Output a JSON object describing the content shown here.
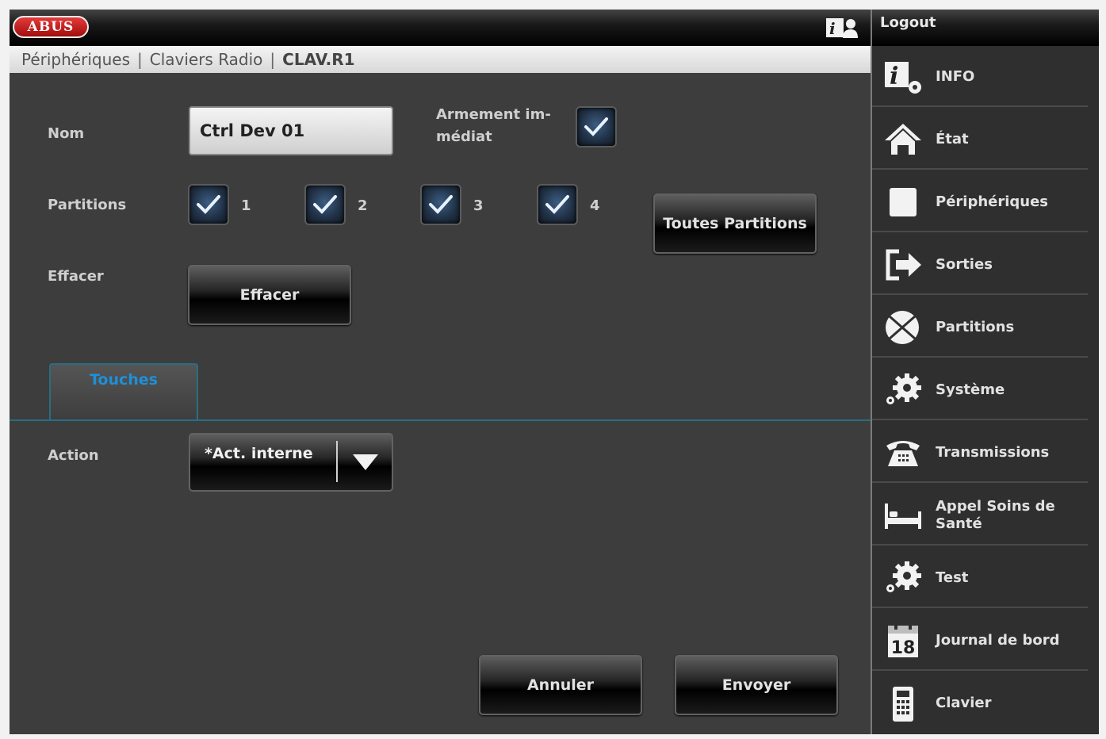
{
  "header": {
    "logo_text": "ABUS",
    "logout_label": "Logout"
  },
  "breadcrumb": {
    "items": [
      "Périphériques",
      "Claviers Radio"
    ],
    "current": "CLAV.R1",
    "separator": "|"
  },
  "form": {
    "nom_label": "Nom",
    "nom_value": "Ctrl Dev 01",
    "armement_label_line1": "Armement im-",
    "armement_label_line2": "médiat",
    "armement_checked": true,
    "partitions_label": "Partitions",
    "partitions": [
      {
        "number": "1",
        "checked": true
      },
      {
        "number": "2",
        "checked": true
      },
      {
        "number": "3",
        "checked": true
      },
      {
        "number": "4",
        "checked": true
      }
    ],
    "toutes_partitions_label": "Toutes Partitions",
    "effacer_label": "Effacer",
    "effacer_button": "Effacer",
    "tab_label": "Touches",
    "action_label": "Action",
    "action_value": "*Act. interne",
    "annuler_label": "Annuler",
    "envoyer_label": "Envoyer"
  },
  "sidebar": {
    "items": [
      {
        "label": "INFO",
        "icon": "info-gear-icon"
      },
      {
        "label": "État",
        "icon": "home-icon"
      },
      {
        "label": "Périphériques",
        "icon": "square-device-icon"
      },
      {
        "label": "Sorties",
        "icon": "exit-arrow-icon"
      },
      {
        "label": "Partitions",
        "icon": "partitions-pie-icon"
      },
      {
        "label": "Système",
        "icon": "gears-icon"
      },
      {
        "label": "Transmissions",
        "icon": "telephone-icon"
      },
      {
        "label": "Appel Soins de Santé",
        "icon": "bed-icon"
      },
      {
        "label": "Test",
        "icon": "gears-icon"
      },
      {
        "label": "Journal de bord",
        "icon": "calendar-icon"
      },
      {
        "label": "Clavier",
        "icon": "keypad-icon"
      }
    ],
    "calendar_day": "18"
  },
  "colors": {
    "accent": "#2a6d85",
    "tab_text": "#1e90d8",
    "logo_red": "#c41e1e",
    "checkbox_blue": "#2e4a6b"
  }
}
